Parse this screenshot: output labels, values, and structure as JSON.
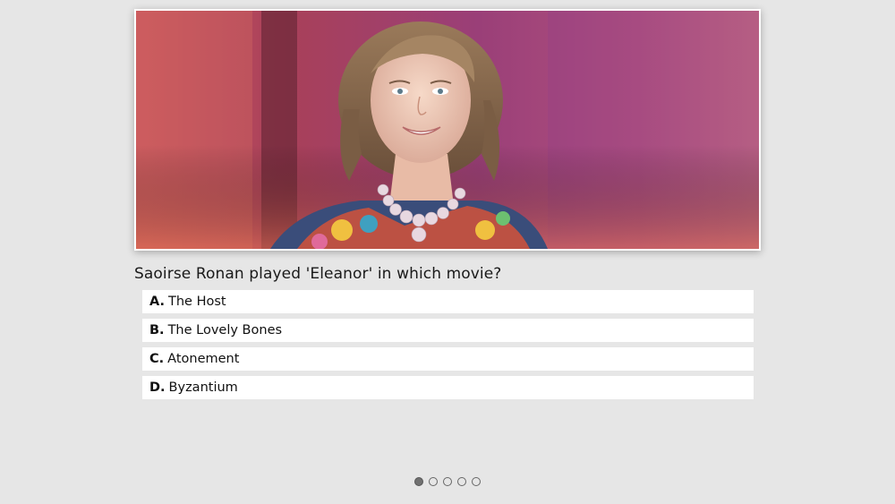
{
  "photo": {
    "subject_icon": "portrait-photo"
  },
  "quiz": {
    "question": "Saoirse Ronan played 'Eleanor' in which movie?",
    "answers": [
      {
        "letter": "A.",
        "text": "The Host"
      },
      {
        "letter": "B.",
        "text": "The Lovely Bones"
      },
      {
        "letter": "C.",
        "text": "Atonement"
      },
      {
        "letter": "D.",
        "text": "Byzantium"
      }
    ]
  },
  "pager": {
    "total_pages": 5,
    "current_page": 1
  },
  "colors": {
    "background": "#e6e6e6",
    "answer_bg": "#ffffff",
    "photo_bg": "#b04a78",
    "active_dot": "#707070"
  }
}
